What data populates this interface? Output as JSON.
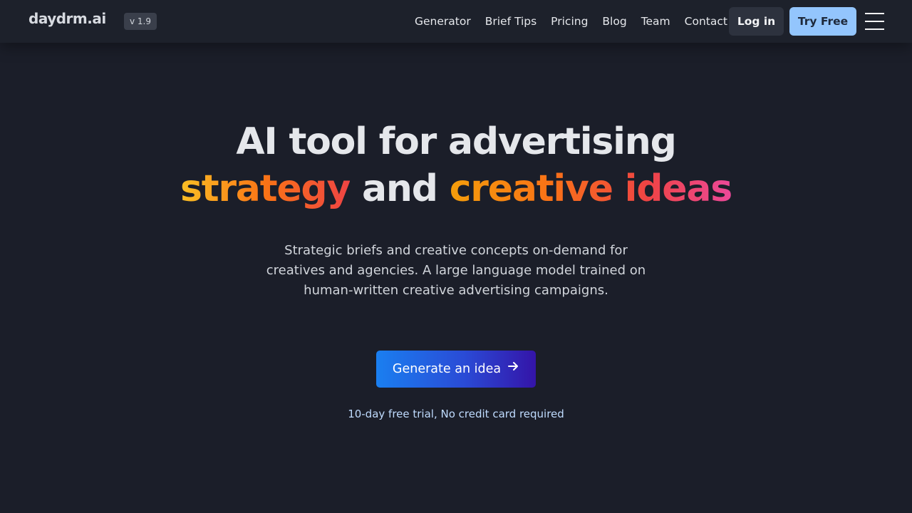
{
  "header": {
    "logo": "daydrm.ai",
    "version": "v 1.9",
    "nav": [
      "Generator",
      "Brief Tips",
      "Pricing",
      "Blog",
      "Team",
      "Contact"
    ],
    "login_label": "Log in",
    "try_label": "Try Free",
    "menu_icon": "hamburger-menu-icon"
  },
  "hero": {
    "title_line1": "AI tool for advertising",
    "title_line2_part1": "strategy",
    "title_line2_part2": "and",
    "title_line2_part3": "creative ideas",
    "subtitle": "Strategic briefs and creative concepts on-demand for creatives and agencies. A large language model trained on human-written creative advertising campaigns.",
    "cta_label": "Generate an idea",
    "cta_icon": "arrow-right-icon",
    "trial_note": "10-day free trial, No credit card required"
  },
  "colors": {
    "background": "#1b1e29",
    "header_bg": "#1d212b",
    "try_button": "#93c5fd",
    "gradient_start": "#fbbf24",
    "gradient_end": "#ec4899",
    "cta_start": "#1a7ff0",
    "cta_end": "#3414a8"
  }
}
